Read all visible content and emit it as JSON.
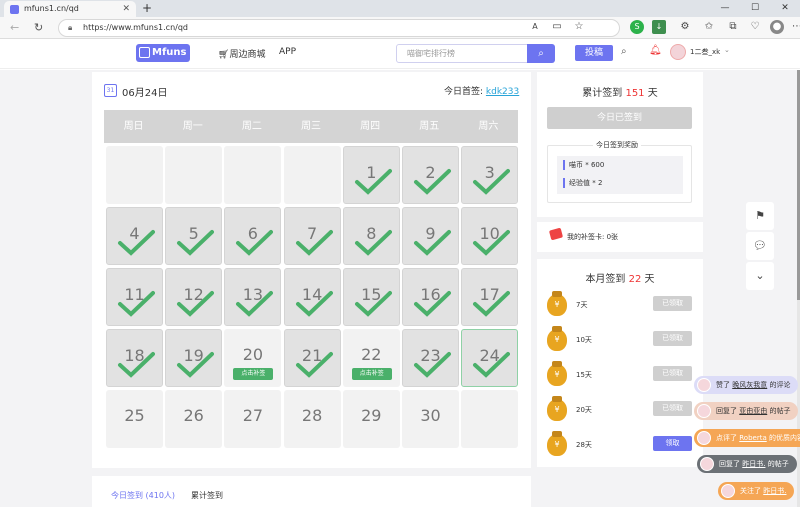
{
  "browser": {
    "tab_title": "mfuns1.cn/qd",
    "new_tab": "+",
    "url": "https://www.mfuns1.cn/qd",
    "window_controls": [
      "—",
      "☐",
      "✕"
    ]
  },
  "site_header": {
    "logo": "Mfuns",
    "nav_shop": "周边商城",
    "nav_app": "APP",
    "search_placeholder": "喵御宅排行榜",
    "post_button": "投稿",
    "username": "1二叁_xk"
  },
  "checkin": {
    "date": "06月24日",
    "first_label": "今日首签:",
    "first_user": "kdk233",
    "weekdays": [
      "周日",
      "周一",
      "周二",
      "周三",
      "周四",
      "周五",
      "周六"
    ],
    "days": [
      {
        "n": "",
        "state": "empty"
      },
      {
        "n": "",
        "state": "empty"
      },
      {
        "n": "",
        "state": "empty"
      },
      {
        "n": "",
        "state": "empty"
      },
      {
        "n": "1",
        "state": "signed"
      },
      {
        "n": "2",
        "state": "signed"
      },
      {
        "n": "3",
        "state": "signed"
      },
      {
        "n": "4",
        "state": "signed"
      },
      {
        "n": "5",
        "state": "signed"
      },
      {
        "n": "6",
        "state": "signed"
      },
      {
        "n": "7",
        "state": "signed"
      },
      {
        "n": "8",
        "state": "signed"
      },
      {
        "n": "9",
        "state": "signed"
      },
      {
        "n": "10",
        "state": "signed"
      },
      {
        "n": "11",
        "state": "signed"
      },
      {
        "n": "12",
        "state": "signed"
      },
      {
        "n": "13",
        "state": "signed"
      },
      {
        "n": "14",
        "state": "signed"
      },
      {
        "n": "15",
        "state": "signed"
      },
      {
        "n": "16",
        "state": "signed"
      },
      {
        "n": "17",
        "state": "signed"
      },
      {
        "n": "18",
        "state": "signed"
      },
      {
        "n": "19",
        "state": "signed"
      },
      {
        "n": "20",
        "state": "missed"
      },
      {
        "n": "21",
        "state": "signed"
      },
      {
        "n": "22",
        "state": "missed"
      },
      {
        "n": "23",
        "state": "signed"
      },
      {
        "n": "24",
        "state": "today"
      },
      {
        "n": "25",
        "state": "future"
      },
      {
        "n": "26",
        "state": "future"
      },
      {
        "n": "27",
        "state": "future"
      },
      {
        "n": "28",
        "state": "future"
      },
      {
        "n": "29",
        "state": "future"
      },
      {
        "n": "30",
        "state": "future"
      },
      {
        "n": "",
        "state": "empty"
      }
    ],
    "makeup_label": "点击补签",
    "tab_today": "今日签到 (410人)",
    "tab_total": "累计签到"
  },
  "summary": {
    "total_prefix": "累计签到",
    "total_value": "151",
    "total_suffix": "天",
    "done_button": "今日已签到",
    "reward_title": "今日签到奖励",
    "rewards": [
      "喵币 * 600",
      "经验值 * 2"
    ],
    "makeup_card": "我的补签卡: 0张",
    "month_prefix": "本月签到",
    "month_value": "22",
    "month_suffix": "天",
    "milestones": [
      {
        "days": "7天",
        "button": "已领取",
        "active": false
      },
      {
        "days": "10天",
        "button": "已领取",
        "active": false
      },
      {
        "days": "15天",
        "button": "已领取",
        "active": false
      },
      {
        "days": "20天",
        "button": "已领取",
        "active": false
      },
      {
        "days": "28天",
        "button": "领取",
        "active": true
      }
    ],
    "coin_symbol": "¥"
  },
  "toasts": [
    {
      "pre": "赞了",
      "link": "晚风灰我意",
      "post": "的评论",
      "bg": "#dcdcf7"
    },
    {
      "pre": "回复了",
      "link": "亚由亚由",
      "post": "的帖子",
      "bg": "#f1d1c2"
    },
    {
      "pre": "点评了",
      "link": "Roberta",
      "post": "的优质内容",
      "bg": "#f5a655"
    },
    {
      "pre": "回复了",
      "link": "昨日书.",
      "post": "的帖子",
      "bg": "#6c7176"
    },
    {
      "pre": "关注了",
      "link": "昨日书.",
      "post": "",
      "bg": "#f5a655"
    }
  ],
  "colors": {
    "accent": "#6d74f0",
    "check": "#4ab06a",
    "highlight": "#e33"
  }
}
